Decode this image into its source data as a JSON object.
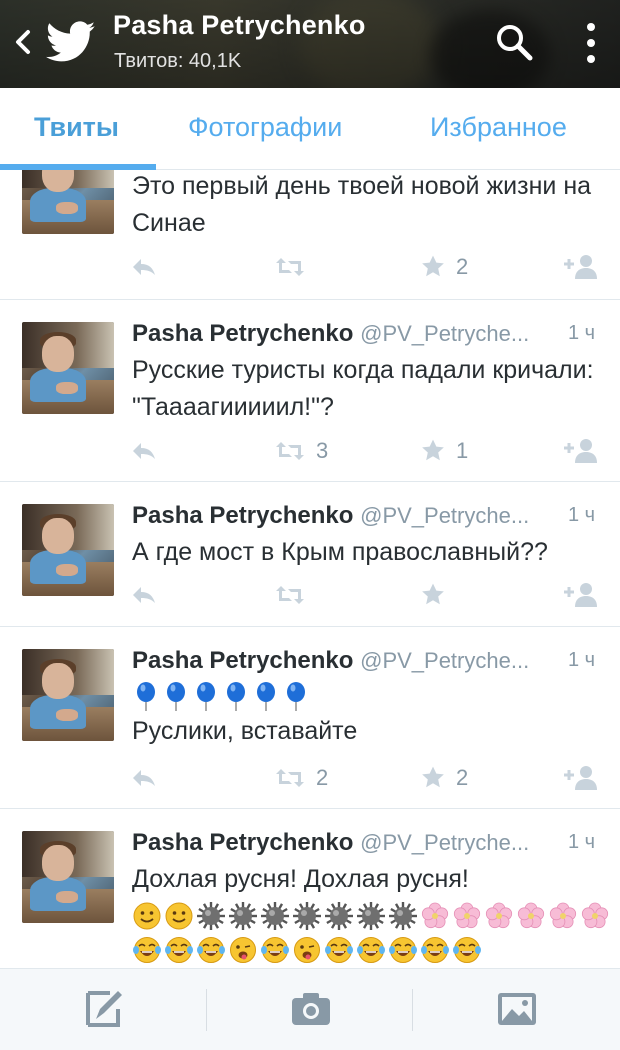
{
  "header": {
    "name": "Pasha Petrychenko",
    "tweet_count": "Твитов: 40,1K",
    "icons": {
      "back": "chevron-left-icon",
      "logo": "twitter-bird-icon",
      "search": "search-icon",
      "menu": "overflow-menu-icon"
    }
  },
  "tabs": [
    {
      "label": "Твиты",
      "active": true
    },
    {
      "label": "Фотографии",
      "active": false
    },
    {
      "label": "Избранное",
      "active": false
    }
  ],
  "colors": {
    "accent": "#55acee",
    "text": "#292f33",
    "muted": "#8899a6",
    "divider": "#e1e8ed"
  },
  "tweets": [
    {
      "text": "Это первый день твоей новой жизни на Синае",
      "retweets": "",
      "favorites": "2"
    },
    {
      "name": "Pasha Petrychenko",
      "handle": "@PV_Petryche...",
      "time": "1 ч",
      "text": "Русские туристы когда падали кричали: \"Таааагииииил!\"?",
      "retweets": "3",
      "favorites": "1"
    },
    {
      "name": "Pasha Petrychenko",
      "handle": "@PV_Petryche...",
      "time": "1 ч",
      "text": "А где мост в Крым православный??",
      "retweets": "",
      "favorites": ""
    },
    {
      "name": "Pasha Petrychenko",
      "handle": "@PV_Petryche...",
      "time": "1 ч",
      "emoji": [
        "blue-balloon",
        "blue-balloon",
        "blue-balloon",
        "blue-balloon",
        "blue-balloon",
        "blue-balloon"
      ],
      "text": "Руслики, вставайте",
      "retweets": "2",
      "favorites": "2"
    },
    {
      "name": "Pasha Petrychenko",
      "handle": "@PV_Petryche...",
      "time": "1 ч",
      "text": "Дохлая русня! Дохлая русня!",
      "emoji_row1": [
        "smile",
        "smile",
        "spiked-ball",
        "spiked-ball",
        "spiked-ball",
        "spiked-ball",
        "spiked-ball",
        "spiked-ball",
        "spiked-ball",
        "cherry-blossom",
        "cherry-blossom",
        "cherry-blossom",
        "cherry-blossom",
        "cherry-blossom",
        "cherry-blossom"
      ],
      "emoji_row2": [
        "tears-of-joy",
        "tears-of-joy",
        "tears-of-joy",
        "winking-tongue",
        "tears-of-joy",
        "winking-tongue",
        "tears-of-joy",
        "tears-of-joy",
        "tears-of-joy",
        "tears-of-joy",
        "tears-of-joy"
      ]
    }
  ],
  "bottom_bar": {
    "icons": [
      "compose-icon",
      "camera-icon",
      "gallery-icon"
    ]
  }
}
